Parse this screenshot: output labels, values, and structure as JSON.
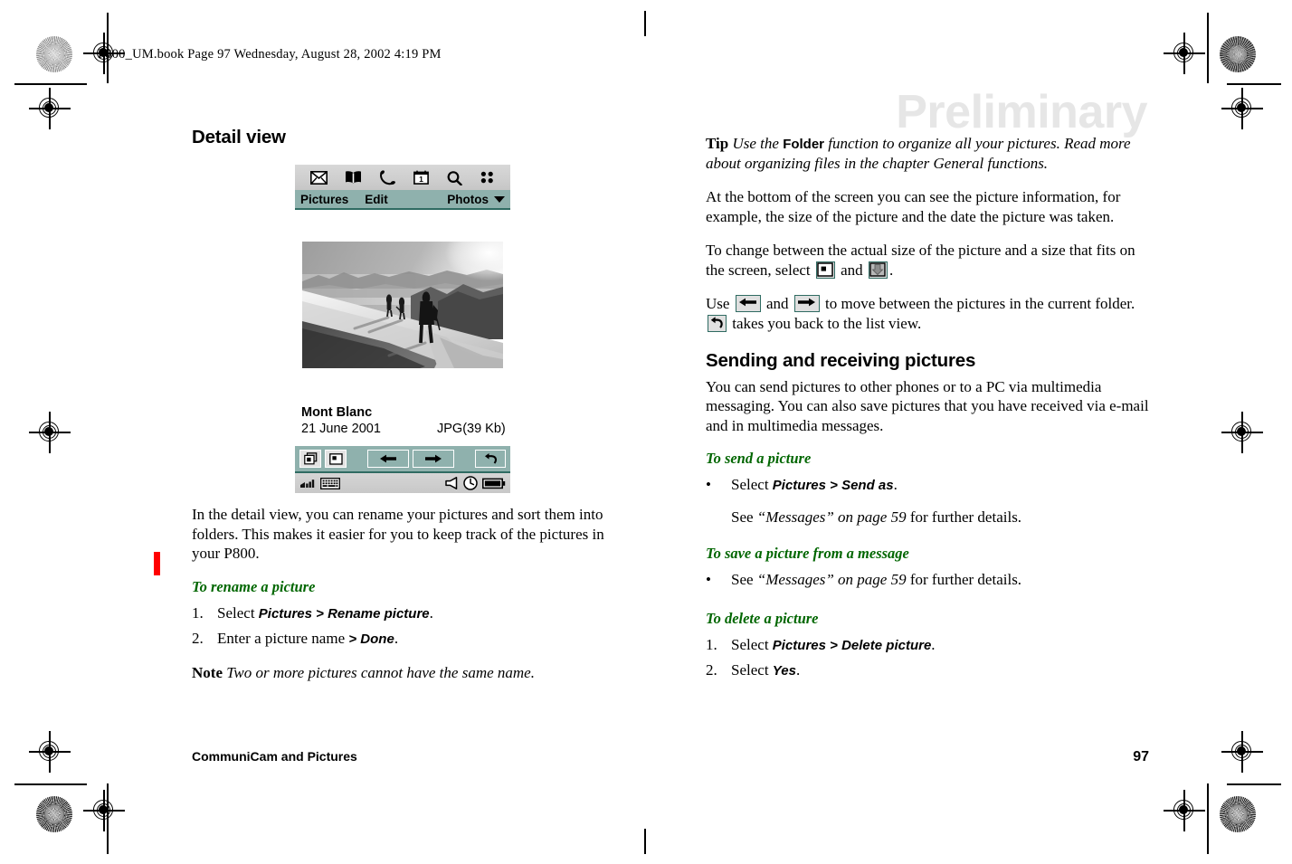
{
  "header": {
    "filestamp": "P800_UM.book  Page 97  Wednesday, August 28, 2002  4:19 PM"
  },
  "watermark": "Preliminary",
  "left_column": {
    "heading": "Detail view",
    "body_paragraph": "In the detail view, you can rename your pictures and sort them into folders. This makes it easier for you to keep track of the pictures in your P800.",
    "procedure_rename": {
      "title": "To rename a picture",
      "steps": [
        {
          "num": "1.",
          "pre": "Select ",
          "cmd": "Pictures > Rename picture",
          "post": "."
        },
        {
          "num": "2.",
          "pre": "Enter a picture name ",
          "cmd": "> Done",
          "post": "."
        }
      ]
    },
    "note": {
      "label": "Note",
      "text": "Two or more pictures cannot have the same name."
    }
  },
  "phone": {
    "toolbar_icons": [
      "envelope-icon",
      "book-icon",
      "phone-handset-icon",
      "calendar-icon",
      "magnifier-icon",
      "grid-apps-icon"
    ],
    "menubar": {
      "items": [
        "Pictures",
        "Edit"
      ],
      "right_item": "Photos",
      "right_chevron": "chevron-down-icon"
    },
    "photo": {
      "alt": "Black and white photograph of three climbers walking along a snowy mountain ridge at sunrise"
    },
    "picture_info": {
      "name": "Mont Blanc",
      "date": "21 June 2001",
      "format": "JPG(39 Kb)"
    },
    "button_bar": [
      "actual-size-icon",
      "fit-to-screen-icon",
      "previous-picture-icon",
      "next-picture-icon",
      "back-to-list-icon"
    ],
    "status_bar": [
      "signal-strength-icon",
      "keyboard-icon",
      "speaker-icon",
      "clock-icon",
      "battery-icon"
    ]
  },
  "right_column": {
    "tip": {
      "label": "Tip",
      "pre": " Use the ",
      "cmd": "Folder",
      "post": " function to organize all your pictures. Read more about organizing files in the chapter General functions."
    },
    "paragraph_bottom_info": "At the bottom of the screen you can see the picture information, for example, the size of the picture and the date the picture was taken.",
    "paragraph_change_size": {
      "pre": "To change between the actual size of the picture and a size that fits on the screen, select ",
      "mid": " and ",
      "post": "."
    },
    "paragraph_navigate": {
      "pre": "Use ",
      "mid1": " and ",
      "mid2": " to move between the pictures in the current folder. ",
      "post": " takes you back to the list view."
    },
    "heading": "Sending and receiving pictures",
    "body_paragraph": "You can send pictures to other phones or to a PC via multimedia messaging. You can also save pictures that you have received via e-mail and in multimedia messages.",
    "procedure_send": {
      "title": "To send a picture",
      "bullet": {
        "marker": "•",
        "pre": "Select ",
        "cmd": "Pictures > Send as",
        "post": "."
      },
      "see": {
        "pre": "See ",
        "ref": "“Messages” on page 59",
        "post": " for further details."
      }
    },
    "procedure_save": {
      "title": "To save a picture from a message",
      "bullet": {
        "marker": "•",
        "pre": "See ",
        "ref": "“Messages” on page 59",
        "post": " for further details."
      }
    },
    "procedure_delete": {
      "title": "To delete a picture",
      "steps": [
        {
          "num": "1.",
          "pre": "Select ",
          "cmd": "Pictures > Delete picture",
          "post": "."
        },
        {
          "num": "2.",
          "pre": "Select ",
          "cmd": "Yes",
          "post": "."
        }
      ]
    }
  },
  "footer": {
    "chapter": "CommuniCam and Pictures",
    "page_number": "97"
  },
  "colors": {
    "accent_teal": "#8fb1ad",
    "teal_rule": "#2f6b62",
    "procedure_green": "#006600",
    "change_bar_red": "#ff0000",
    "watermark_gray": "#e6e6e6"
  }
}
